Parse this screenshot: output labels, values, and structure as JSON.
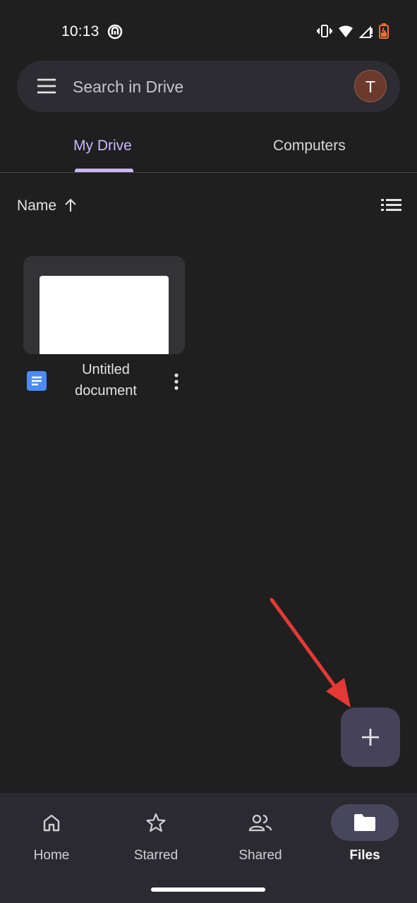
{
  "status_bar": {
    "time": "10:13",
    "icons": [
      "app-notification-icon",
      "vibrate-icon",
      "wifi-icon",
      "signal-icon",
      "battery-icon"
    ]
  },
  "search": {
    "placeholder": "Search in Drive",
    "avatar_letter": "T",
    "avatar_color": "#6b3a2c"
  },
  "tabs": [
    {
      "label": "My Drive",
      "selected": true
    },
    {
      "label": "Computers",
      "selected": false
    }
  ],
  "sort": {
    "label": "Name",
    "direction": "ascending",
    "view_icon": "list-view-icon"
  },
  "files": [
    {
      "name": "Untitled document",
      "type_icon": "google-docs-icon"
    }
  ],
  "fab": {
    "icon": "plus-icon"
  },
  "annotation": {
    "type": "red-arrow",
    "color": "#e53935"
  },
  "bottom_nav": [
    {
      "label": "Home",
      "icon": "home-icon",
      "selected": false
    },
    {
      "label": "Starred",
      "icon": "star-icon",
      "selected": false
    },
    {
      "label": "Shared",
      "icon": "people-icon",
      "selected": false
    },
    {
      "label": "Files",
      "icon": "folder-icon",
      "selected": true
    }
  ],
  "colors": {
    "background": "#1f1f1f",
    "accent": "#c9b8ff",
    "search_bar": "#2d2c32",
    "nav_bar": "#2b2a30",
    "fab": "#45425a"
  }
}
